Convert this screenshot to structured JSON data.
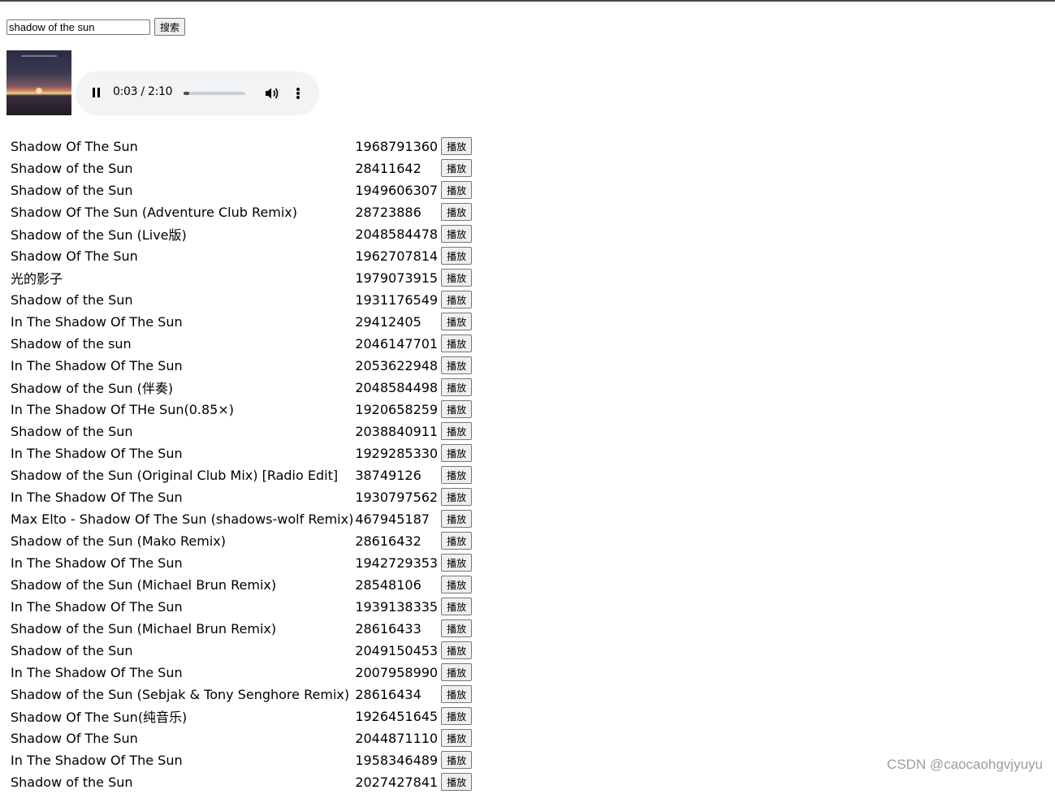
{
  "search": {
    "value": "shadow of the sun",
    "button_label": "搜索"
  },
  "player": {
    "current_time": "0:03",
    "duration": "2:10",
    "time_display": "0:03 / 2:10",
    "progress": 0.023,
    "state": "playing",
    "icons": [
      "pause-icon",
      "volume-icon",
      "more-vertical-icon"
    ]
  },
  "songs": [
    {
      "name": "Shadow Of The Sun",
      "id": "1968791360"
    },
    {
      "name": "Shadow of the Sun",
      "id": "28411642"
    },
    {
      "name": "Shadow of the Sun",
      "id": "1949606307"
    },
    {
      "name": "Shadow Of The Sun (Adventure Club Remix)",
      "id": "28723886"
    },
    {
      "name": "Shadow of the Sun (Live版)",
      "id": "2048584478"
    },
    {
      "name": "Shadow Of The Sun",
      "id": "1962707814"
    },
    {
      "name": "光的影子",
      "id": "1979073915"
    },
    {
      "name": "Shadow of the Sun",
      "id": "1931176549"
    },
    {
      "name": "In The Shadow Of The Sun",
      "id": "29412405"
    },
    {
      "name": "Shadow of the sun",
      "id": "2046147701"
    },
    {
      "name": "In The Shadow Of The Sun",
      "id": "2053622948"
    },
    {
      "name": "Shadow of the Sun (伴奏)",
      "id": "2048584498"
    },
    {
      "name": "In The Shadow Of THe Sun(0.85×)",
      "id": "1920658259"
    },
    {
      "name": "Shadow of the Sun",
      "id": "2038840911"
    },
    {
      "name": "In The Shadow Of The Sun",
      "id": "1929285330"
    },
    {
      "name": "Shadow of the Sun (Original Club Mix) [Radio Edit]",
      "id": "38749126"
    },
    {
      "name": "In The Shadow Of The Sun",
      "id": "1930797562"
    },
    {
      "name": "Max Elto - Shadow Of The Sun (shadows-wolf Remix)",
      "id": "467945187"
    },
    {
      "name": "Shadow of the Sun (Mako Remix)",
      "id": "28616432"
    },
    {
      "name": "In The Shadow Of The Sun",
      "id": "1942729353"
    },
    {
      "name": "Shadow of the Sun (Michael Brun Remix)",
      "id": "28548106"
    },
    {
      "name": "In The Shadow Of The Sun",
      "id": "1939138335"
    },
    {
      "name": "Shadow of the Sun (Michael Brun Remix)",
      "id": "28616433"
    },
    {
      "name": "Shadow of the Sun",
      "id": "2049150453"
    },
    {
      "name": "In The Shadow Of The Sun",
      "id": "2007958990"
    },
    {
      "name": "Shadow of the Sun (Sebjak & Tony Senghore Remix)",
      "id": "28616434"
    },
    {
      "name": "Shadow Of The Sun(纯音乐)",
      "id": "1926451645"
    },
    {
      "name": "Shadow Of The Sun",
      "id": "2044871110"
    },
    {
      "name": "In The Shadow Of The Sun",
      "id": "1958346489"
    },
    {
      "name": "Shadow of the Sun",
      "id": "2027427841"
    }
  ],
  "play_label": "播放",
  "watermark": "CSDN @caocaohgvjyuyu"
}
